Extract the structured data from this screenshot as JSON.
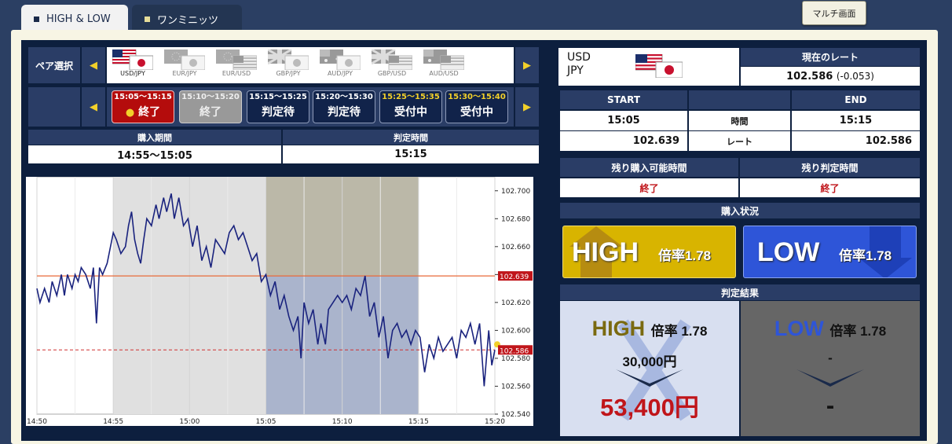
{
  "tabs": {
    "high_low": "HIGH & LOW",
    "one_minute": "ワンミニッツ"
  },
  "multi_screen": "マルチ画面",
  "pair_select": {
    "label": "ペア選択",
    "pairs": [
      {
        "label": "USD/JPY"
      },
      {
        "label": "EUR/JPY"
      },
      {
        "label": "EUR/USD"
      },
      {
        "label": "GBP/JPY"
      },
      {
        "label": "AUD/JPY"
      },
      {
        "label": "GBP/USD"
      },
      {
        "label": "AUD/USD"
      }
    ]
  },
  "time_slots": [
    {
      "time": "15:05〜15:15",
      "status": "終了"
    },
    {
      "time": "15:10〜15:20",
      "status": "終了"
    },
    {
      "time": "15:15〜15:25",
      "status": "判定待"
    },
    {
      "time": "15:20〜15:30",
      "status": "判定待"
    },
    {
      "time": "15:25〜15:35",
      "status": "受付中"
    },
    {
      "time": "15:30〜15:40",
      "status": "受付中"
    }
  ],
  "purchase_period": {
    "label": "購入期間",
    "value": "14:55〜15:05"
  },
  "judge_time": {
    "label": "判定時間",
    "value": "15:15"
  },
  "chart_data": {
    "type": "line",
    "x_ticks": [
      "14:50",
      "14:55",
      "15:00",
      "15:05",
      "15:10",
      "15:15",
      "15:20"
    ],
    "y_ticks": [
      "102.700",
      "102.680",
      "102.660",
      "102.640",
      "102.620",
      "102.600",
      "102.580",
      "102.560",
      "102.540"
    ],
    "ylim": [
      102.54,
      102.71
    ],
    "start_rate": "102.639",
    "current_rate": "102.586",
    "series": [
      {
        "values": [
          [
            0,
            102.63
          ],
          [
            0.2,
            102.62
          ],
          [
            0.5,
            102.63
          ],
          [
            0.8,
            102.62
          ],
          [
            1.0,
            102.635
          ],
          [
            1.3,
            102.625
          ],
          [
            1.6,
            102.64
          ],
          [
            1.8,
            102.625
          ],
          [
            2.0,
            102.64
          ],
          [
            2.3,
            102.63
          ],
          [
            2.5,
            102.64
          ],
          [
            2.7,
            102.635
          ],
          [
            2.9,
            102.645
          ],
          [
            3.2,
            102.64
          ],
          [
            3.5,
            102.63
          ],
          [
            3.7,
            102.645
          ],
          [
            3.9,
            102.605
          ],
          [
            4.1,
            102.645
          ],
          [
            4.3,
            102.64
          ],
          [
            4.6,
            102.648
          ],
          [
            5.0,
            102.67
          ],
          [
            5.2,
            102.665
          ],
          [
            5.5,
            102.655
          ],
          [
            5.8,
            102.66
          ],
          [
            6.0,
            102.675
          ],
          [
            6.2,
            102.685
          ],
          [
            6.4,
            102.665
          ],
          [
            6.6,
            102.655
          ],
          [
            6.8,
            102.648
          ],
          [
            7.0,
            102.665
          ],
          [
            7.2,
            102.68
          ],
          [
            7.5,
            102.675
          ],
          [
            7.8,
            102.69
          ],
          [
            8.0,
            102.68
          ],
          [
            8.3,
            102.695
          ],
          [
            8.5,
            102.685
          ],
          [
            8.8,
            102.698
          ],
          [
            9.0,
            102.68
          ],
          [
            9.3,
            102.695
          ],
          [
            9.6,
            102.675
          ],
          [
            9.9,
            102.68
          ],
          [
            10.2,
            102.66
          ],
          [
            10.5,
            102.675
          ],
          [
            10.8,
            102.65
          ],
          [
            11.1,
            102.66
          ],
          [
            11.4,
            102.645
          ],
          [
            11.7,
            102.665
          ],
          [
            12.0,
            102.66
          ],
          [
            12.3,
            102.655
          ],
          [
            12.6,
            102.67
          ],
          [
            12.9,
            102.675
          ],
          [
            13.2,
            102.665
          ],
          [
            13.5,
            102.67
          ],
          [
            13.8,
            102.66
          ],
          [
            14.1,
            102.65
          ],
          [
            14.4,
            102.655
          ],
          [
            14.7,
            102.635
          ],
          [
            15.0,
            102.64
          ],
          [
            15.3,
            102.625
          ],
          [
            15.6,
            102.635
          ],
          [
            15.9,
            102.615
          ],
          [
            16.2,
            102.625
          ],
          [
            16.5,
            102.61
          ],
          [
            16.8,
            102.6
          ],
          [
            17.1,
            102.61
          ],
          [
            17.3,
            102.58
          ],
          [
            17.5,
            102.62
          ],
          [
            17.8,
            102.605
          ],
          [
            18.1,
            102.615
          ],
          [
            18.4,
            102.59
          ],
          [
            18.6,
            102.605
          ],
          [
            18.9,
            102.59
          ],
          [
            19.1,
            102.615
          ],
          [
            19.4,
            102.62
          ],
          [
            19.7,
            102.625
          ],
          [
            20.0,
            102.62
          ],
          [
            20.3,
            102.625
          ],
          [
            20.6,
            102.615
          ],
          [
            20.9,
            102.63
          ],
          [
            21.2,
            102.625
          ],
          [
            21.5,
            102.639
          ],
          [
            21.8,
            102.61
          ],
          [
            22.1,
            102.62
          ],
          [
            22.4,
            102.595
          ],
          [
            22.7,
            102.61
          ],
          [
            23.0,
            102.58
          ],
          [
            23.3,
            102.6
          ],
          [
            23.6,
            102.605
          ],
          [
            23.9,
            102.595
          ],
          [
            24.2,
            102.6
          ],
          [
            24.5,
            102.59
          ],
          [
            24.8,
            102.6
          ],
          [
            25.1,
            102.595
          ],
          [
            25.4,
            102.57
          ],
          [
            25.7,
            102.59
          ],
          [
            26.0,
            102.58
          ],
          [
            26.3,
            102.595
          ],
          [
            26.6,
            102.585
          ],
          [
            26.9,
            102.59
          ],
          [
            27.2,
            102.595
          ],
          [
            27.5,
            102.58
          ],
          [
            27.8,
            102.6
          ],
          [
            28.1,
            102.595
          ],
          [
            28.4,
            102.605
          ],
          [
            28.7,
            102.59
          ],
          [
            29.0,
            102.605
          ],
          [
            29.3,
            102.56
          ],
          [
            29.6,
            102.6
          ],
          [
            29.8,
            102.575
          ],
          [
            30.0,
            102.586
          ]
        ]
      }
    ]
  },
  "pair_info": {
    "base": "USD",
    "quote": "JPY",
    "rate_label": "現在のレート",
    "rate": "102.586",
    "change": "(-0.053)"
  },
  "summary": {
    "start_label": "START",
    "end_label": "END",
    "time_label": "時間",
    "rate_label": "レート",
    "start_time": "15:05",
    "end_time": "15:15",
    "start_rate": "102.639",
    "end_rate": "102.586"
  },
  "remaining": {
    "buy_label": "残り購入可能時間",
    "judge_label": "残り判定時間",
    "buy_value": "終了",
    "judge_value": "終了"
  },
  "purchase_status": {
    "label": "購入状況",
    "high": {
      "label": "HIGH",
      "rate": "倍率1.78"
    },
    "low": {
      "label": "LOW",
      "rate": "倍率1.78"
    }
  },
  "result": {
    "label": "判定結果",
    "high": {
      "label": "HIGH",
      "rate": "倍率 1.78",
      "amount": "30,000円",
      "payout": "53,400円"
    },
    "low": {
      "label": "LOW",
      "rate": "倍率 1.78",
      "amount": "-",
      "payout": "-"
    }
  },
  "colors": {
    "navy": "#0d1f3e",
    "header": "#2a3d66",
    "gold": "#f2d02a",
    "red": "#c0151a",
    "high_gold": "#d8b400",
    "low_blue": "#2e55d8"
  }
}
